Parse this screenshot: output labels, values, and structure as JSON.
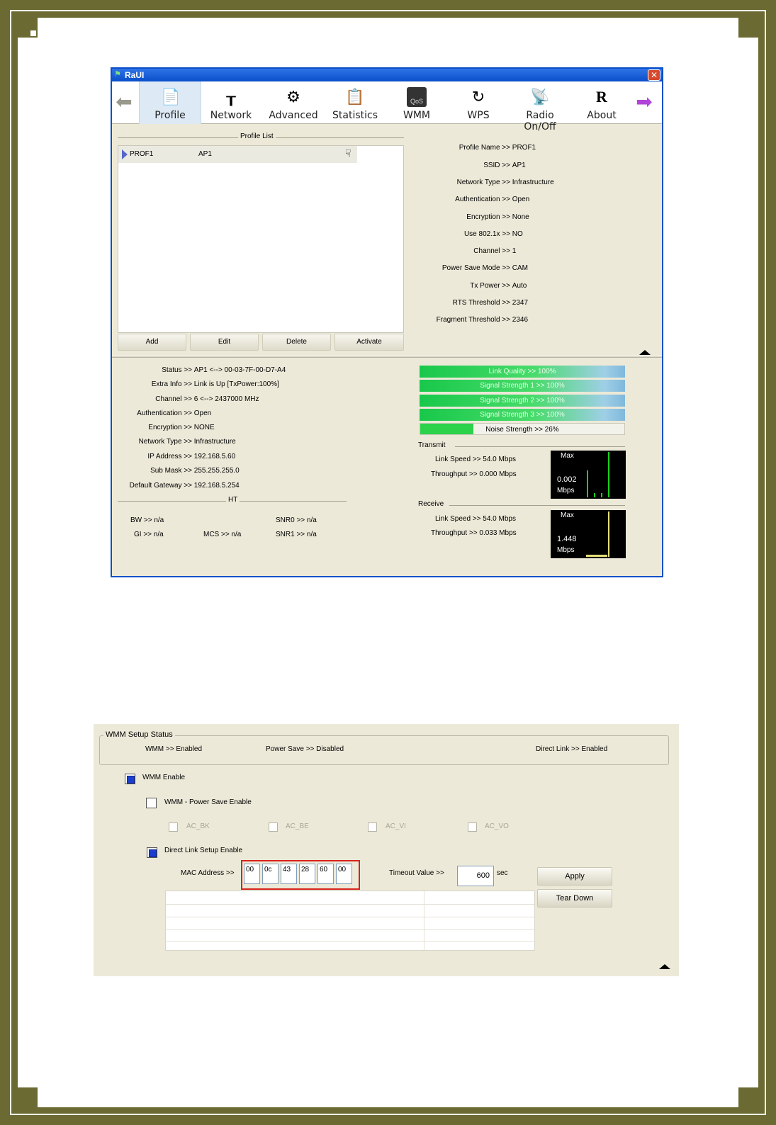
{
  "raui": {
    "title": "RaUI",
    "toolbar": {
      "items": [
        {
          "label": "Profile",
          "icon": "profile-icon"
        },
        {
          "label": "Network",
          "icon": "network-icon"
        },
        {
          "label": "Advanced",
          "icon": "advanced-icon"
        },
        {
          "label": "Statistics",
          "icon": "statistics-icon"
        },
        {
          "label": "WMM",
          "icon": "wmm-icon",
          "badge": "QoS"
        },
        {
          "label": "WPS",
          "icon": "wps-icon"
        },
        {
          "label": "Radio On/Off",
          "icon": "radio-icon"
        },
        {
          "label": "About",
          "icon": "about-icon"
        }
      ]
    },
    "profile_list": {
      "title": "Profile List",
      "rows": [
        {
          "name": "PROF1",
          "ssid": "AP1"
        }
      ],
      "buttons": {
        "add": "Add",
        "edit": "Edit",
        "delete": "Delete",
        "activate": "Activate"
      }
    },
    "profile_details": [
      {
        "k": "Profile Name >>",
        "v": "PROF1"
      },
      {
        "k": "SSID >>",
        "v": "AP1"
      },
      {
        "k": "Network Type >>",
        "v": "Infrastructure"
      },
      {
        "k": "Authentication >>",
        "v": "Open"
      },
      {
        "k": "Encryption >>",
        "v": "None"
      },
      {
        "k": "Use 802.1x >>",
        "v": "NO"
      },
      {
        "k": "Channel >>",
        "v": "1"
      },
      {
        "k": "Power Save Mode >>",
        "v": "CAM"
      },
      {
        "k": "Tx Power >>",
        "v": "Auto"
      },
      {
        "k": "RTS Threshold >>",
        "v": "2347"
      },
      {
        "k": "Fragment Threshold >>",
        "v": "2346"
      }
    ],
    "status": [
      {
        "k": "Status >>",
        "v": "AP1 <--> 00-03-7F-00-D7-A4"
      },
      {
        "k": "Extra Info >>",
        "v": "Link is Up [TxPower:100%]"
      },
      {
        "k": "Channel >>",
        "v": "6 <--> 2437000 MHz"
      },
      {
        "k": "Authentication >>",
        "v": "Open"
      },
      {
        "k": "Encryption >>",
        "v": "NONE"
      },
      {
        "k": "Network Type >>",
        "v": "Infrastructure"
      },
      {
        "k": "IP Address >>",
        "v": "192.168.5.60"
      },
      {
        "k": "Sub Mask >>",
        "v": "255.255.255.0"
      },
      {
        "k": "Default Gateway >>",
        "v": "192.168.5.254"
      }
    ],
    "ht": {
      "title": "HT",
      "bw": "BW >> n/a",
      "gi": "GI >> n/a",
      "mcs": "MCS >> n/a",
      "snr0": "SNR0 >> n/a",
      "snr1": "SNR1 >> n/a"
    },
    "bars": {
      "link_quality": "Link Quality >> 100%",
      "signal1": "Signal Strength 1 >> 100%",
      "signal2": "Signal Strength 2 >> 100%",
      "signal3": "Signal Strength 3 >> 100%",
      "noise": "Noise Strength >> 26%",
      "noise_level": 0.26
    },
    "transmit": {
      "title": "Transmit",
      "link_speed": "Link Speed >> 54.0 Mbps",
      "throughput": "Throughput >> 0.000 Mbps",
      "chart_max": "Max",
      "chart_value": "0.002",
      "chart_unit": "Mbps"
    },
    "receive": {
      "title": "Receive",
      "link_speed": "Link Speed >> 54.0 Mbps",
      "throughput": "Throughput >> 0.033 Mbps",
      "chart_max": "Max",
      "chart_value": "1.448",
      "chart_unit": "Mbps"
    }
  },
  "wmm": {
    "status_title": "WMM Setup Status",
    "status_wmm": "WMM >> Enabled",
    "status_power_save": "Power Save >> Disabled",
    "status_direct_link": "Direct Link >> Enabled",
    "wmm_enable": {
      "label": "WMM Enable",
      "checked": true
    },
    "power_save_enable": {
      "label": "WMM - Power Save Enable",
      "checked": false
    },
    "ac": [
      "AC_BK",
      "AC_BE",
      "AC_VI",
      "AC_VO"
    ],
    "dls_enable": {
      "label": "Direct Link Setup Enable",
      "checked": true
    },
    "mac_label": "MAC Address >>",
    "mac": [
      "00",
      "0c",
      "43",
      "28",
      "60",
      "00"
    ],
    "timeout_label": "Timeout Value >>",
    "timeout_value": "600",
    "timeout_unit": "sec",
    "apply": "Apply",
    "tear_down": "Tear Down"
  }
}
